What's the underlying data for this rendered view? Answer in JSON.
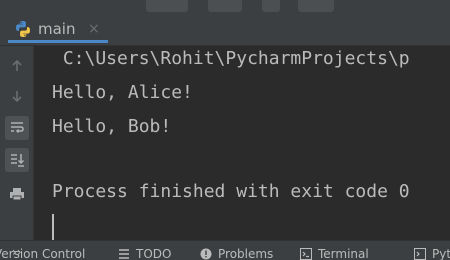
{
  "editor_tab": {
    "label": "main",
    "close_glyph": "×",
    "icon": "python-file-icon"
  },
  "sidebar": {
    "buttons": [
      {
        "name": "up-arrow-icon",
        "active": false
      },
      {
        "name": "down-arrow-icon",
        "active": false
      },
      {
        "name": "soft-wrap-icon",
        "active": true
      },
      {
        "name": "scroll-to-end-icon",
        "active": true
      },
      {
        "name": "print-icon",
        "active": false
      }
    ],
    "more_glyph": "››"
  },
  "console": {
    "lines": [
      " C:\\Users\\Rohit\\PycharmProjects\\p",
      "Hello, Alice!",
      "Hello, Bob!",
      "",
      "Process finished with exit code 0"
    ]
  },
  "statusbar": {
    "items": [
      {
        "label": "Version Control",
        "icon": ""
      },
      {
        "label": "TODO",
        "icon": "todo-list-icon"
      },
      {
        "label": "Problems",
        "icon": "problems-icon"
      },
      {
        "label": "Terminal",
        "icon": "terminal-icon"
      },
      {
        "label": "Pytho",
        "icon": "python-console-icon"
      }
    ]
  },
  "colors": {
    "accent": "#4a88c7",
    "background": "#2b2b2b",
    "panel": "#3c3f41",
    "text": "#bbbbbb"
  }
}
